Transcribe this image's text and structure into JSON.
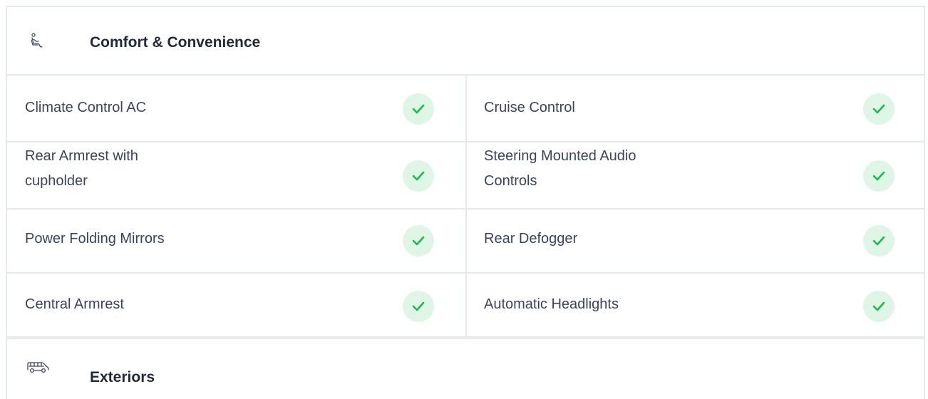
{
  "sections": {
    "comfort": {
      "title": "Comfort & Convenience",
      "icon": "seat-icon"
    },
    "exteriors": {
      "title": "Exteriors",
      "icon": "car-icon"
    }
  },
  "features": [
    {
      "left": "Climate Control AC",
      "right": "Cruise Control"
    },
    {
      "left": "Rear Armrest with cupholder",
      "right": "Steering Mounted Audio Controls"
    },
    {
      "left": "Power Folding Mirrors",
      "right": "Rear Defogger"
    },
    {
      "left": "Central Armrest",
      "right": "Automatic Headlights"
    }
  ],
  "colors": {
    "check_bg": "#dff5e6",
    "check_mark": "#1fb84f",
    "border": "#e6e9ee"
  }
}
